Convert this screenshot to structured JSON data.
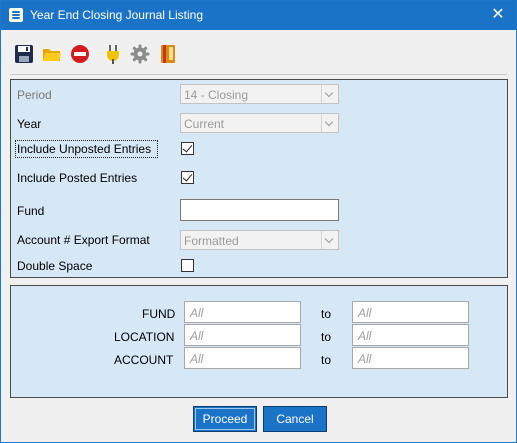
{
  "window": {
    "title": "Year End Closing Journal Listing",
    "close_glyph": "✕"
  },
  "toolbar": {
    "icons": [
      "save-icon",
      "open-folder-icon",
      "cancel-icon",
      "plug-icon",
      "settings-gear-icon",
      "help-book-icon"
    ]
  },
  "form": {
    "period": {
      "label": "Period",
      "value": "14 - Closing"
    },
    "year": {
      "label": "Year",
      "value": "Current"
    },
    "include_unposted": {
      "label": "Include Unposted Entries",
      "checked": true
    },
    "include_posted": {
      "label": "Include Posted Entries",
      "checked": true
    },
    "fund": {
      "label": "Fund",
      "value": ""
    },
    "export_format": {
      "label": "Account # Export Format",
      "value": "Formatted"
    },
    "double_space": {
      "label": "Double Space",
      "checked": false
    }
  },
  "ranges": {
    "to_label": "to",
    "rows": [
      {
        "label": "FUND",
        "from_placeholder": "All",
        "to_placeholder": "All"
      },
      {
        "label": "LOCATION",
        "from_placeholder": "All",
        "to_placeholder": "All"
      },
      {
        "label": "ACCOUNT",
        "from_placeholder": "All",
        "to_placeholder": "All"
      }
    ]
  },
  "buttons": {
    "proceed": "Proceed",
    "cancel": "Cancel"
  },
  "colors": {
    "title_bar": "#1a73c6",
    "panel": "#d6e7f6",
    "button": "#1a73c6"
  }
}
